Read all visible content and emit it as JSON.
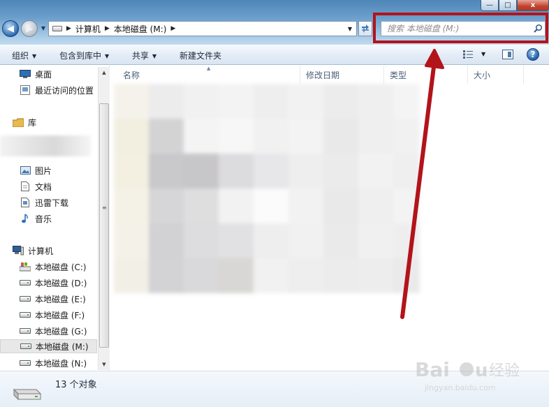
{
  "window": {
    "minimize_glyph": "—",
    "maximize_glyph": "□",
    "close_glyph": "x"
  },
  "address": {
    "crumbs": [
      "计算机",
      "本地磁盘 (M:)"
    ]
  },
  "search": {
    "placeholder": "搜索 本地磁盘 (M:)"
  },
  "toolbar": {
    "organize": "组织",
    "include_in_library": "包含到库中",
    "share": "共享",
    "new_folder": "新建文件夹",
    "help": "?"
  },
  "navigation": {
    "favorites": [
      {
        "label": "桌面",
        "icon": "desktop-icon"
      },
      {
        "label": "最近访问的位置",
        "icon": "recent-places-icon"
      }
    ],
    "libraries_header": "库",
    "libraries": [
      {
        "label": "图片",
        "icon": "pictures-icon"
      },
      {
        "label": "文档",
        "icon": "documents-icon"
      },
      {
        "label": "迅雷下载",
        "icon": "download-folder-icon"
      },
      {
        "label": "音乐",
        "icon": "music-icon"
      }
    ],
    "computer_header": "计算机",
    "drives": [
      {
        "label": "本地磁盘 (C:)",
        "selected": false
      },
      {
        "label": "本地磁盘 (D:)",
        "selected": false
      },
      {
        "label": "本地磁盘 (E:)",
        "selected": false
      },
      {
        "label": "本地磁盘 (F:)",
        "selected": false
      },
      {
        "label": "本地磁盘 (G:)",
        "selected": false
      },
      {
        "label": "本地磁盘 (M:)",
        "selected": true
      },
      {
        "label": "本地磁盘 (N:)",
        "selected": false
      }
    ]
  },
  "filelist": {
    "columns": [
      "名称",
      "修改日期",
      "类型",
      "大小"
    ]
  },
  "status": {
    "count": "13 个对象"
  },
  "watermark": {
    "brand": "Baidu经验",
    "url": "jingyan.baidu.com"
  },
  "colors": {
    "highlight": "#b3131a",
    "chrome_top": "#4f86b8",
    "chrome_bottom": "#c3dcf0"
  }
}
